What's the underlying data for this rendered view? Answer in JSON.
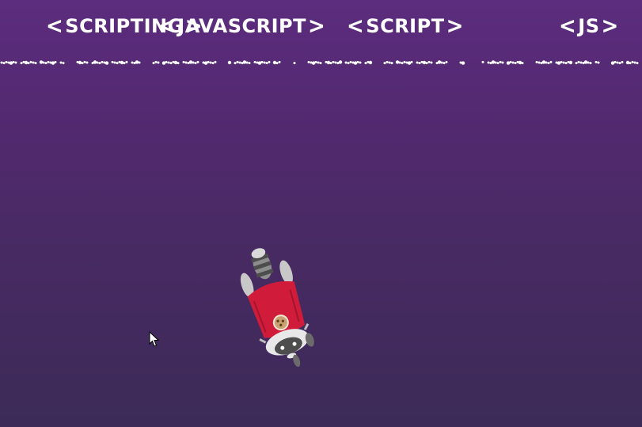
{
  "falling_words": [
    {
      "text": "SCRIPTING",
      "open": "<",
      "close": ">"
    },
    {
      "text": "JAVASCRIPT",
      "open": "<",
      "close": ">"
    },
    {
      "text": "SCRIPT",
      "open": "<",
      "close": ">"
    },
    {
      "text": "JS",
      "open": "<",
      "close": ">"
    }
  ],
  "colors": {
    "background_top": "#5c2c7e",
    "background_bottom": "#3c2b58",
    "text": "#ffffff",
    "rocket_red": "#d01c3a",
    "racoon_gray": "#9a9a9a"
  },
  "sprites": {
    "player": "rocket-racoon-icon",
    "pointer": "mouse-cursor-icon"
  }
}
